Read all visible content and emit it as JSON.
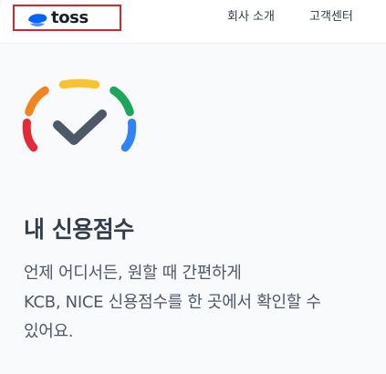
{
  "header": {
    "logo_text": "toss",
    "nav": {
      "about": "회사 소개",
      "support": "고객센터"
    }
  },
  "main": {
    "title": "내 신용점수",
    "description_lines": [
      "언제 어디서든, 원할 때 간편하게",
      "KCB, NICE 신용점수를 한 곳에서 확인할 수",
      "있어요."
    ]
  },
  "icons": {
    "logo": "toss-logo-icon",
    "hero": "credit-score-gauge-check-icon"
  },
  "colors": {
    "logo_blue": "#0064ff",
    "highlight_border": "#d7262b",
    "gauge_red": "#e42939",
    "gauge_orange": "#f2831f",
    "gauge_yellow": "#f9c230",
    "gauge_green": "#1aa65b",
    "gauge_blue": "#3182f6",
    "check_gray": "#4e5968"
  }
}
